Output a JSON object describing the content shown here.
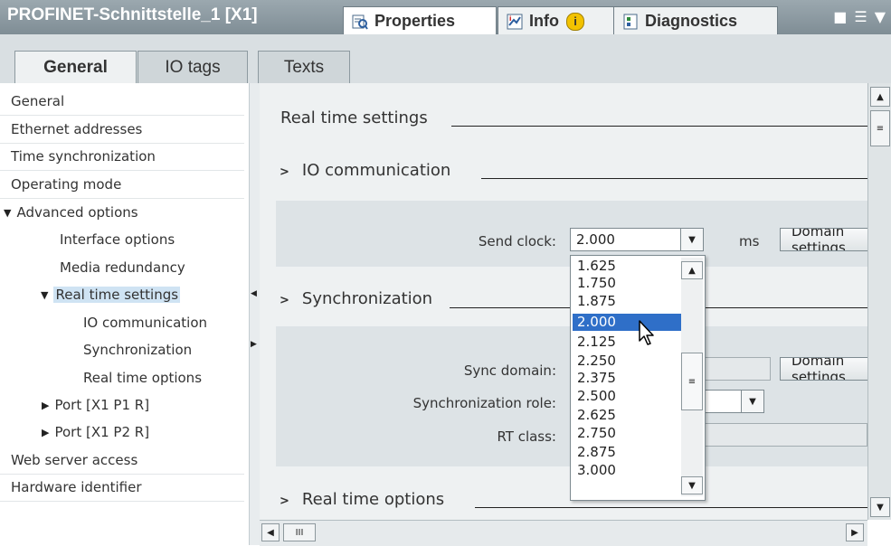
{
  "window": {
    "title": "PROFINET-Schnittstelle_1 [X1]",
    "tabs": [
      {
        "label": "Properties",
        "icon": "properties-icon"
      },
      {
        "label": "Info",
        "icon": "info-icon"
      },
      {
        "label": "Diagnostics",
        "icon": "diagnostics-icon"
      }
    ]
  },
  "subtabs": [
    "General",
    "IO tags",
    "Texts"
  ],
  "nav": {
    "items": [
      {
        "label": "General"
      },
      {
        "label": "Ethernet addresses"
      },
      {
        "label": "Time synchronization"
      },
      {
        "label": "Operating mode"
      },
      {
        "label": "Advanced options"
      },
      {
        "label": "Interface options"
      },
      {
        "label": "Media redundancy"
      },
      {
        "label": "Real time settings"
      },
      {
        "label": "IO communication"
      },
      {
        "label": "Synchronization"
      },
      {
        "label": "Real time options"
      },
      {
        "label": "Port [X1 P1 R]"
      },
      {
        "label": "Port [X1 P2 R]"
      },
      {
        "label": "Web server access"
      },
      {
        "label": "Hardware identifier"
      }
    ]
  },
  "content": {
    "heading": "Real time settings",
    "io_comm": {
      "heading": "IO communication",
      "send_clock_label": "Send clock:",
      "send_clock_value": "2.000",
      "unit": "ms",
      "domain_button": "Domain settings"
    },
    "sync": {
      "heading": "Synchronization",
      "sync_domain_label": "Sync domain:",
      "sync_role_label": "Synchronization role:",
      "rt_class_label": "RT class:",
      "domain_button": "Domain settings"
    },
    "rt_options": {
      "heading": "Real time options"
    }
  },
  "dropdown": {
    "options": [
      "1.625",
      "1.750",
      "1.875",
      "2.000",
      "2.125",
      "2.250",
      "2.375",
      "2.500",
      "2.625",
      "2.750",
      "2.875",
      "3.000"
    ],
    "selected": "2.000"
  },
  "hscroll_grip": "III"
}
